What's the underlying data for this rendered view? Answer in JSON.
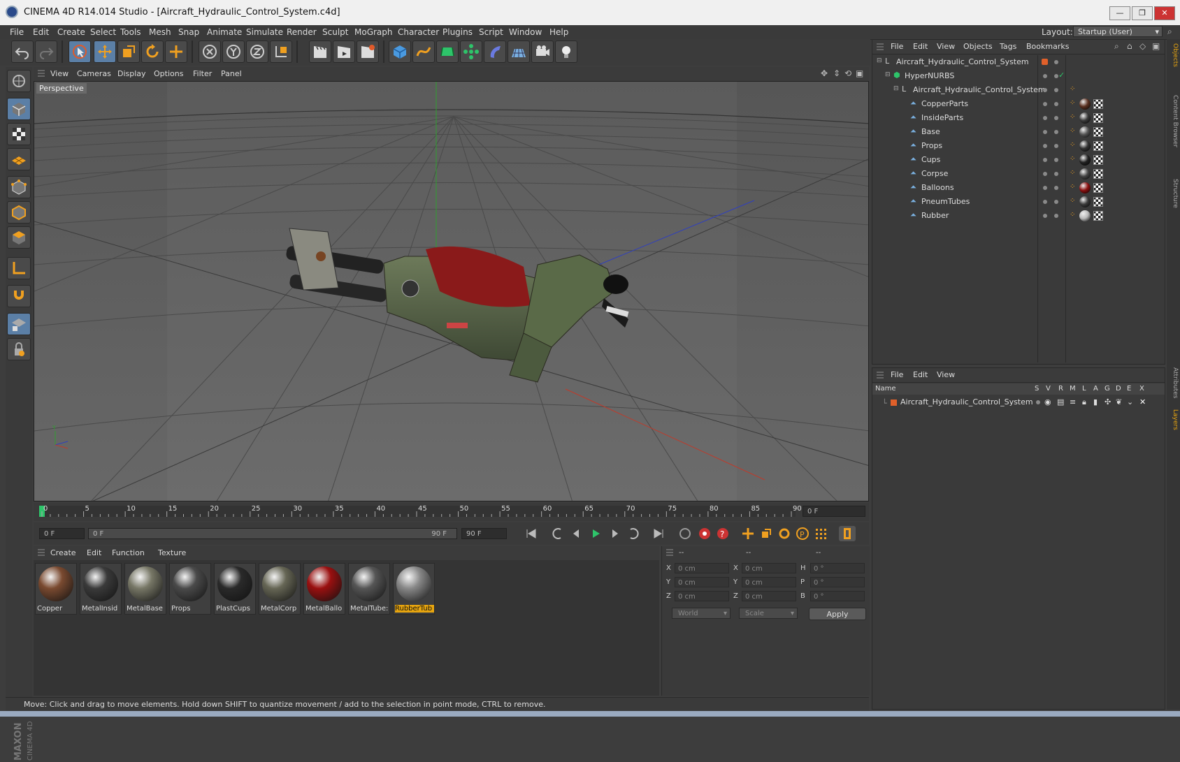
{
  "window": {
    "title": "CINEMA 4D R14.014 Studio - [Aircraft_Hydraulic_Control_System.c4d]",
    "min": "—",
    "max": "❐",
    "close": "✕"
  },
  "menubar": {
    "items": [
      "File",
      "Edit",
      "Create",
      "Select",
      "Tools",
      "Mesh",
      "Snap",
      "Animate",
      "Simulate",
      "Render",
      "Sculpt",
      "MoGraph",
      "Character",
      "Plugins",
      "Script",
      "Window",
      "Help"
    ],
    "layout_label": "Layout:",
    "layout_value": "Startup (User)"
  },
  "viewport": {
    "menu": [
      "View",
      "Cameras",
      "Display",
      "Options",
      "Filter",
      "Panel"
    ],
    "label": "Perspective"
  },
  "timeline": {
    "ticks": [
      "0",
      "5",
      "10",
      "15",
      "20",
      "25",
      "30",
      "35",
      "40",
      "45",
      "50",
      "55",
      "60",
      "65",
      "70",
      "75",
      "80",
      "85",
      "90"
    ],
    "current_frame": "0 F",
    "start_field": "0 F",
    "range_start": "0 F",
    "range_end": "90 F",
    "end_field": "90 F"
  },
  "materials": {
    "menu": [
      "Create",
      "Edit",
      "Function",
      "Texture"
    ],
    "items": [
      {
        "name": "Copper",
        "color": "#7a4a30"
      },
      {
        "name": "MetalInsid",
        "color": "#3a3a3a"
      },
      {
        "name": "MetalBase",
        "color": "#777766"
      },
      {
        "name": "Props",
        "color": "#4a4a4a"
      },
      {
        "name": "PlastCups",
        "color": "#2a2a2a"
      },
      {
        "name": "MetalCorp",
        "color": "#666655"
      },
      {
        "name": "MetalBallo",
        "color": "#9a1010"
      },
      {
        "name": "MetalTube:",
        "color": "#555555"
      },
      {
        "name": "RubberTub",
        "color": "#888888"
      }
    ],
    "selected": "RubberTub"
  },
  "coords": {
    "headers": [
      "--",
      "--",
      "--"
    ],
    "rows": [
      {
        "a": "X",
        "av": "0 cm",
        "b": "X",
        "bv": "0 cm",
        "c": "H",
        "cv": "0 °"
      },
      {
        "a": "Y",
        "av": "0 cm",
        "b": "Y",
        "bv": "0 cm",
        "c": "P",
        "cv": "0 °"
      },
      {
        "a": "Z",
        "av": "0 cm",
        "b": "Z",
        "bv": "0 cm",
        "c": "B",
        "cv": "0 °"
      }
    ],
    "space": "World",
    "mode": "Scale",
    "apply": "Apply"
  },
  "status": {
    "text": "Move: Click and drag to move elements. Hold down SHIFT to quantize movement / add to the selection in point mode, CTRL to remove."
  },
  "objects": {
    "menu": [
      "File",
      "Edit",
      "View",
      "Objects",
      "Tags",
      "Bookmarks"
    ],
    "tree": [
      {
        "name": "Aircraft_Hydraulic_Control_System",
        "level": 0
      },
      {
        "name": "HyperNURBS",
        "level": 1
      },
      {
        "name": "Aircraft_Hydraulic_Control_System",
        "level": 2
      },
      {
        "name": "CopperParts",
        "level": 3,
        "tag": "#5a3020"
      },
      {
        "name": "InsideParts",
        "level": 3,
        "tag": "#3a3a3a"
      },
      {
        "name": "Base",
        "level": 3,
        "tag": "#555555"
      },
      {
        "name": "Props",
        "level": 3,
        "tag": "#333333"
      },
      {
        "name": "Cups",
        "level": 3,
        "tag": "#222222"
      },
      {
        "name": "Corpse",
        "level": 3,
        "tag": "#444444"
      },
      {
        "name": "Balloons",
        "level": 3,
        "tag": "#8a1010"
      },
      {
        "name": "PneumTubes",
        "level": 3,
        "tag": "#3a3a3a"
      },
      {
        "name": "Rubber",
        "level": 3,
        "tag": "#bbbbbb"
      }
    ]
  },
  "layers": {
    "menu": [
      "File",
      "Edit",
      "View"
    ],
    "columns": [
      "Name",
      "S",
      "V",
      "R",
      "M",
      "L",
      "A",
      "G",
      "D",
      "E",
      "X"
    ],
    "rows": [
      {
        "name": "Aircraft_Hydraulic_Control_System"
      }
    ]
  },
  "sidetabs": [
    "Objects",
    "Content Browser",
    "Structure",
    "Attributes",
    "Layers"
  ],
  "logo": {
    "line1": "MAXON",
    "line2": "CINEMA 4D"
  },
  "colors": {
    "accent": "#e7a50f",
    "active_tool": "#5b7fa6",
    "layer_orange": "#e0602a"
  }
}
